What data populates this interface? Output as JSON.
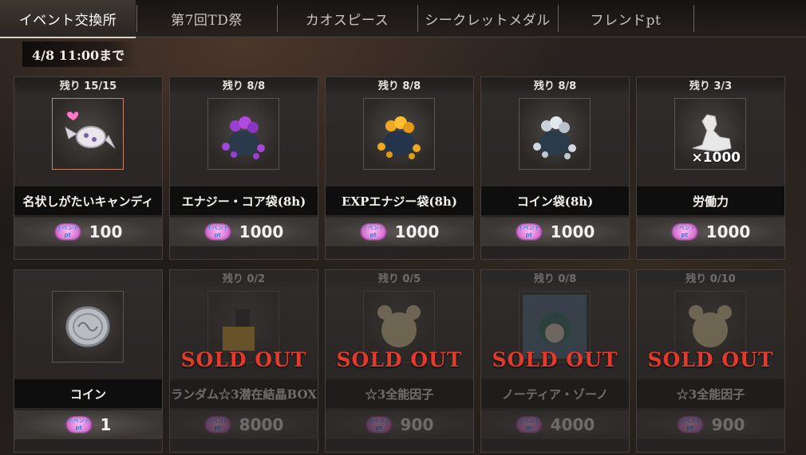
{
  "tabs": [
    {
      "label": "イベント交換所",
      "active": true
    },
    {
      "label": "第7回TD祭",
      "active": false
    },
    {
      "label": "カオスピース",
      "active": false
    },
    {
      "label": "シークレットメダル",
      "active": false
    },
    {
      "label": "フレンドpt",
      "active": false
    }
  ],
  "deadline": "4/8 11:00まで",
  "currency_badge": {
    "line1": "イベント",
    "line2": "pt"
  },
  "sold_out_label": "SOLD OUT",
  "items": [
    {
      "remaining": "残り 15/15",
      "name": "名状しがたいキャンディ",
      "price": "100",
      "icon": "candy-icon",
      "sold_out": false
    },
    {
      "remaining": "残り 8/8",
      "name": "エナジー・コア袋(8h)",
      "price": "1000",
      "icon": "energy-core-bag-icon",
      "sold_out": false
    },
    {
      "remaining": "残り 8/8",
      "name": "EXPエナジー袋(8h)",
      "price": "1000",
      "icon": "exp-energy-bag-icon",
      "sold_out": false
    },
    {
      "remaining": "残り 8/8",
      "name": "コイン袋(8h)",
      "price": "1000",
      "icon": "coin-bag-icon",
      "sold_out": false
    },
    {
      "remaining": "残り 3/3",
      "name": "労働力",
      "price": "1000",
      "icon": "labor-icon",
      "quantity": "×1000",
      "sold_out": false
    },
    {
      "remaining": "",
      "name": "コイン",
      "price": "1",
      "icon": "coin-icon",
      "sold_out": false
    },
    {
      "remaining": "残り 0/2",
      "name": "ランダム☆3潜在結晶BOX",
      "price": "8000",
      "icon": "crystal-box-icon",
      "sold_out": true
    },
    {
      "remaining": "残り 0/5",
      "name": "☆3全能因子",
      "price": "900",
      "icon": "factor-icon",
      "sold_out": true
    },
    {
      "remaining": "残り 0/8",
      "name": "ノーティア・ゾーノ",
      "price": "4000",
      "icon": "character-portrait-icon",
      "sold_out": true
    },
    {
      "remaining": "残り 0/10",
      "name": "☆3全能因子",
      "price": "900",
      "icon": "factor-icon",
      "sold_out": true
    }
  ],
  "colors": {
    "sold_out": "#e23b2e",
    "badge": "#d46ad0"
  }
}
